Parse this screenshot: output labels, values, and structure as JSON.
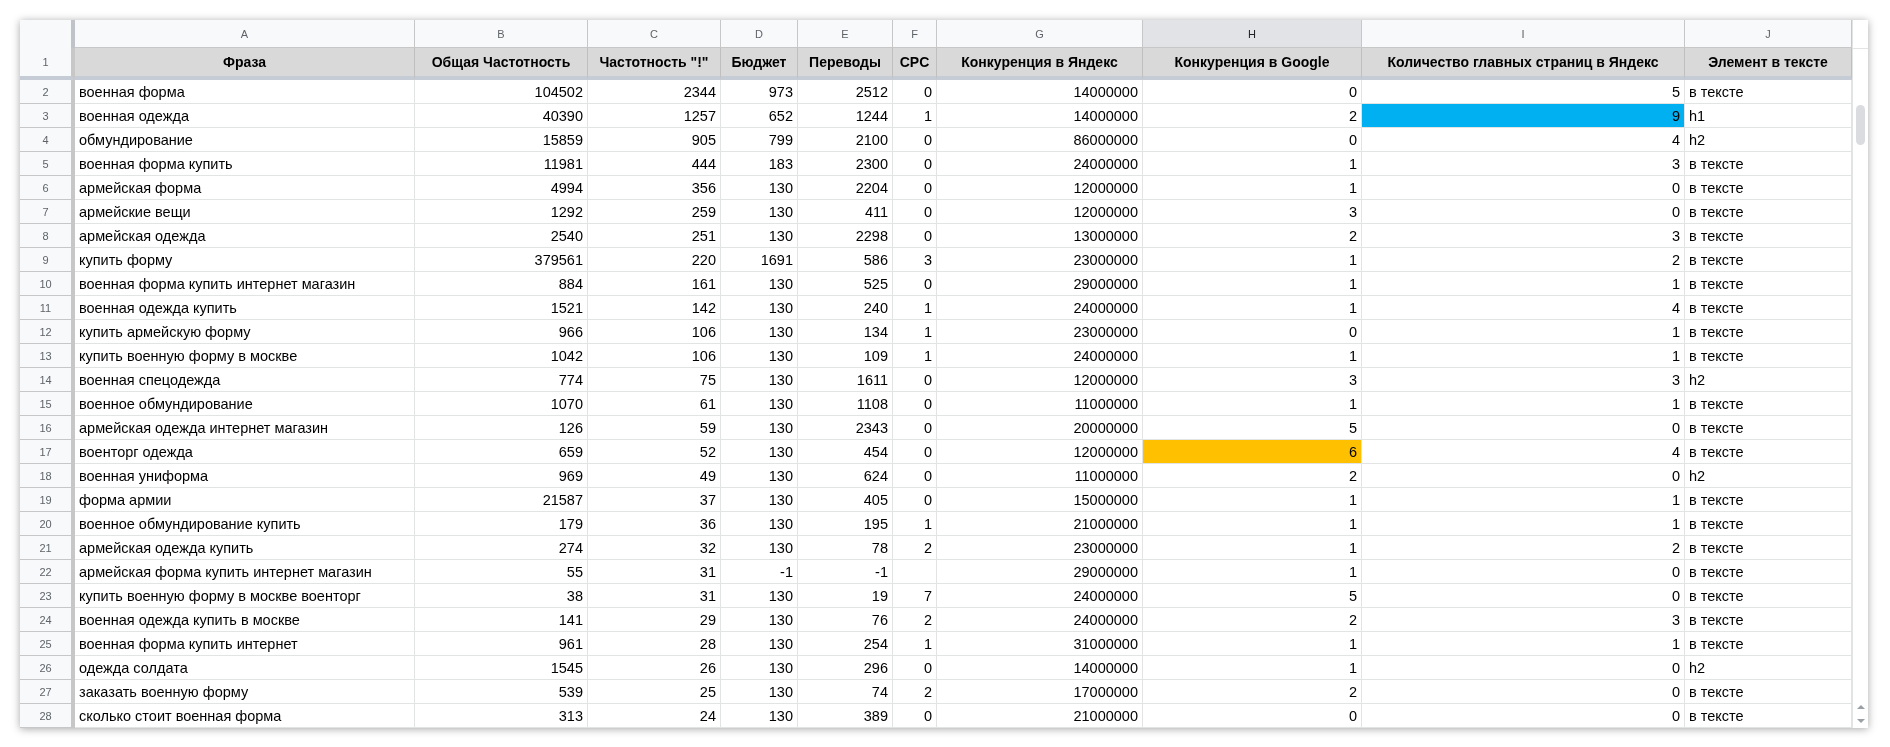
{
  "columns": [
    {
      "letter": "A",
      "heading": "Фраза",
      "kind": "text",
      "selected": false
    },
    {
      "letter": "B",
      "heading": "Общая Частотность",
      "kind": "number",
      "selected": false
    },
    {
      "letter": "C",
      "heading": "Частотность \"!\"",
      "kind": "number",
      "selected": false
    },
    {
      "letter": "D",
      "heading": "Бюджет",
      "kind": "number",
      "selected": false
    },
    {
      "letter": "E",
      "heading": "Переводы",
      "kind": "number",
      "selected": false
    },
    {
      "letter": "F",
      "heading": "CPC",
      "kind": "number",
      "selected": false
    },
    {
      "letter": "G",
      "heading": "Конкуренция в Яндекс",
      "kind": "number",
      "selected": false
    },
    {
      "letter": "H",
      "heading": "Конкуренция в Google",
      "kind": "number",
      "selected": true
    },
    {
      "letter": "I",
      "heading": "Количество главных страниц в Яндекс",
      "kind": "number",
      "selected": false
    },
    {
      "letter": "J",
      "heading": "Элемент в тексте",
      "kind": "text",
      "selected": false
    }
  ],
  "header_row_number": "1",
  "rows": [
    {
      "number": "2",
      "cells": [
        "военная форма",
        "104502",
        "2344",
        "973",
        "2512",
        "0",
        "14000000",
        "0",
        "5",
        "в тексте"
      ]
    },
    {
      "number": "3",
      "cells": [
        "военная одежда",
        "40390",
        "1257",
        "652",
        "1244",
        "1",
        "14000000",
        "2",
        {
          "text": "9",
          "color": "#00b0f0"
        },
        "h1"
      ]
    },
    {
      "number": "4",
      "cells": [
        "обмундирование",
        "15859",
        "905",
        "799",
        "2100",
        "0",
        "86000000",
        "0",
        "4",
        "h2"
      ]
    },
    {
      "number": "5",
      "cells": [
        "военная форма купить",
        "11981",
        "444",
        "183",
        "2300",
        "0",
        "24000000",
        "1",
        "3",
        "в тексте"
      ]
    },
    {
      "number": "6",
      "cells": [
        "армейская форма",
        "4994",
        "356",
        "130",
        "2204",
        "0",
        "12000000",
        "1",
        "0",
        "в тексте"
      ]
    },
    {
      "number": "7",
      "cells": [
        "армейские вещи",
        "1292",
        "259",
        "130",
        "411",
        "0",
        "12000000",
        "3",
        "0",
        "в тексте"
      ]
    },
    {
      "number": "8",
      "cells": [
        "армейская одежда",
        "2540",
        "251",
        "130",
        "2298",
        "0",
        "13000000",
        "2",
        "3",
        "в тексте"
      ]
    },
    {
      "number": "9",
      "cells": [
        "купить форму",
        "379561",
        "220",
        "1691",
        "586",
        "3",
        "23000000",
        "1",
        "2",
        "в тексте"
      ]
    },
    {
      "number": "10",
      "cells": [
        "военная форма купить интернет магазин",
        "884",
        "161",
        "130",
        "525",
        "0",
        "29000000",
        "1",
        "1",
        "в тексте"
      ]
    },
    {
      "number": "11",
      "cells": [
        "военная одежда купить",
        "1521",
        "142",
        "130",
        "240",
        "1",
        "24000000",
        "1",
        "4",
        "в тексте"
      ]
    },
    {
      "number": "12",
      "cells": [
        "купить армейскую форму",
        "966",
        "106",
        "130",
        "134",
        "1",
        "23000000",
        "0",
        "1",
        "в тексте"
      ]
    },
    {
      "number": "13",
      "cells": [
        "купить военную форму в москве",
        "1042",
        "106",
        "130",
        "109",
        "1",
        "24000000",
        "1",
        "1",
        "в тексте"
      ]
    },
    {
      "number": "14",
      "cells": [
        "военная спецодежда",
        "774",
        "75",
        "130",
        "1611",
        "0",
        "12000000",
        "3",
        "3",
        "h2"
      ]
    },
    {
      "number": "15",
      "cells": [
        "военное обмундирование",
        "1070",
        "61",
        "130",
        "1108",
        "0",
        "11000000",
        "1",
        "1",
        "в тексте"
      ]
    },
    {
      "number": "16",
      "cells": [
        "армейская одежда интернет магазин",
        "126",
        "59",
        "130",
        "2343",
        "0",
        "20000000",
        "5",
        "0",
        "в тексте"
      ]
    },
    {
      "number": "17",
      "cells": [
        "военторг одежда",
        "659",
        "52",
        "130",
        "454",
        "0",
        "12000000",
        {
          "text": "6",
          "color": "#ffc000"
        },
        "4",
        "в тексте"
      ]
    },
    {
      "number": "18",
      "cells": [
        "военная униформа",
        "969",
        "49",
        "130",
        "624",
        "0",
        "11000000",
        "2",
        "0",
        "h2"
      ]
    },
    {
      "number": "19",
      "cells": [
        "форма армии",
        "21587",
        "37",
        "130",
        "405",
        "0",
        "15000000",
        "1",
        "1",
        "в тексте"
      ]
    },
    {
      "number": "20",
      "cells": [
        "военное обмундирование купить",
        "179",
        "36",
        "130",
        "195",
        "1",
        "21000000",
        "1",
        "1",
        "в тексте"
      ]
    },
    {
      "number": "21",
      "cells": [
        "армейская одежда купить",
        "274",
        "32",
        "130",
        "78",
        "2",
        "23000000",
        "1",
        "2",
        "в тексте"
      ]
    },
    {
      "number": "22",
      "cells": [
        "армейская форма купить интернет магазин",
        "55",
        "31",
        "-1",
        "-1",
        null,
        "29000000",
        "1",
        "0",
        "в тексте"
      ]
    },
    {
      "number": "23",
      "cells": [
        "купить военную форму в москве военторг",
        "38",
        "31",
        "130",
        "19",
        "7",
        "24000000",
        "5",
        "0",
        "в тексте"
      ]
    },
    {
      "number": "24",
      "cells": [
        "военная одежда купить в москве",
        "141",
        "29",
        "130",
        "76",
        "2",
        "24000000",
        "2",
        "3",
        "в тексте"
      ]
    },
    {
      "number": "25",
      "cells": [
        "военная форма купить интернет",
        "961",
        "28",
        "130",
        "254",
        "1",
        "31000000",
        "1",
        "1",
        "в тексте"
      ]
    },
    {
      "number": "26",
      "cells": [
        "одежда солдата",
        "1545",
        "26",
        "130",
        "296",
        "0",
        "14000000",
        "1",
        "0",
        "h2"
      ]
    },
    {
      "number": "27",
      "cells": [
        "заказать военную форму",
        "539",
        "25",
        "130",
        "74",
        "2",
        "17000000",
        "2",
        "0",
        "в тексте"
      ]
    },
    {
      "number": "28",
      "cells": [
        "сколько стоит военная форма",
        "313",
        "24",
        "130",
        "389",
        "0",
        "21000000",
        "0",
        "0",
        "в тексте"
      ]
    }
  ]
}
